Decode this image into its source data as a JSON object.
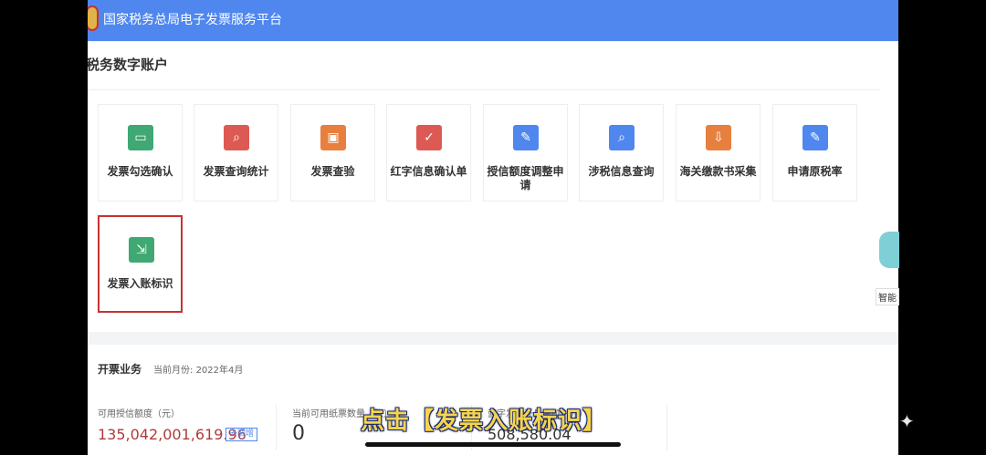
{
  "header": {
    "title": "国家税务总局电子发票服务平台"
  },
  "section": {
    "title": "税务数字账户"
  },
  "cards": [
    {
      "label": "发票勾选确认",
      "icon": "ticket-icon",
      "color": "#3fa873"
    },
    {
      "label": "发票查询统计",
      "icon": "search-document-icon",
      "color": "#dd5a54"
    },
    {
      "label": "发票查验",
      "icon": "ticket-verify-icon",
      "color": "#e77f3f"
    },
    {
      "label": "红字信息确认单",
      "icon": "document-check-icon",
      "color": "#dd5a54"
    },
    {
      "label": "授信额度调整申请",
      "icon": "edit-document-icon",
      "color": "#4f87ef"
    },
    {
      "label": "涉税信息查询",
      "icon": "search-folder-icon",
      "color": "#4f87ef"
    },
    {
      "label": "海关缴款书采集",
      "icon": "download-icon",
      "color": "#e77f3f"
    },
    {
      "label": "申请原税率",
      "icon": "clipboard-edit-icon",
      "color": "#4f87ef"
    },
    {
      "label": "发票入账标识",
      "icon": "import-icon",
      "color": "#3fa873"
    }
  ],
  "business": {
    "title": "开票业务",
    "month_label": "当前月份:",
    "month_value": "2022年4月",
    "credit_label": "可用授信额度（元）",
    "credit_value": "135,042,001,619.96",
    "adjust_label": "去调增",
    "paper_label": "当前可用纸票数量（张）",
    "paper_value": "0",
    "blue_label": "蓝字发票开具金额（元）",
    "blue_value": "508,580.04"
  },
  "assistant": {
    "label": "智能"
  },
  "caption": {
    "text": "点击【发票入账标识】"
  }
}
